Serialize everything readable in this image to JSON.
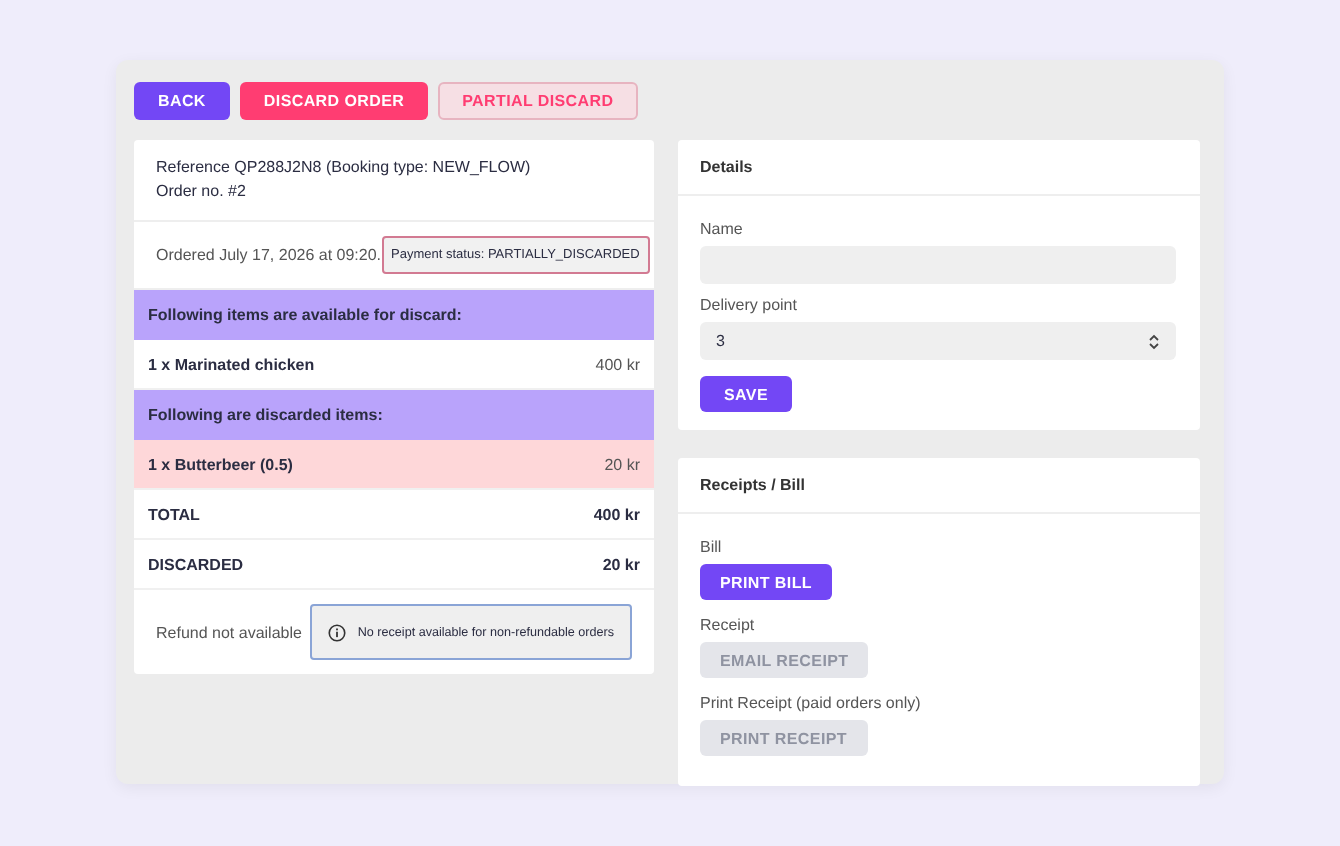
{
  "actions": [
    {
      "label": "BACK",
      "kind": "primary"
    },
    {
      "label": "DISCARD ORDER",
      "kind": "danger"
    },
    {
      "label": "PARTIAL DISCARD",
      "kind": "outline"
    }
  ],
  "order": {
    "reference": "Reference QP288J2N8 (Booking type: NEW_FLOW)",
    "order_no": "Order no. #2",
    "ordered": "Ordered July 17, 2026 at 09:20.",
    "payment_status": "Payment status: PARTIALLY_DISCARDED",
    "sections": [
      {
        "title": "Following items are available for discard:",
        "items": [
          {
            "name": "1 x Marinated chicken",
            "price": "400 kr",
            "discarded": false
          }
        ]
      },
      {
        "title": "Following are discarded items:",
        "items": [
          {
            "name": "1 x Butterbeer (0.5)",
            "price": "20 kr",
            "discarded": true
          }
        ]
      }
    ],
    "totals": [
      {
        "label": "TOTAL",
        "value": "400 kr"
      },
      {
        "label": "DISCARDED",
        "value": "20 kr"
      }
    ],
    "refund": {
      "text": "Refund not available",
      "notice": "No receipt available for non-refundable orders"
    }
  },
  "details": {
    "title": "Details",
    "fields": [
      {
        "label": "Name",
        "kind": "text"
      },
      {
        "label": "Delivery point",
        "kind": "select",
        "value": "3"
      }
    ],
    "save": "SAVE"
  },
  "receipts": {
    "title": "Receipts / Bill",
    "groups": [
      {
        "label": "Bill",
        "button": "PRINT BILL",
        "disabled": false
      },
      {
        "label": "Receipt",
        "button": "EMAIL RECEIPT",
        "disabled": true
      },
      {
        "label": "Print Receipt (paid orders only)",
        "button": "PRINT RECEIPT",
        "disabled": true
      }
    ]
  }
}
